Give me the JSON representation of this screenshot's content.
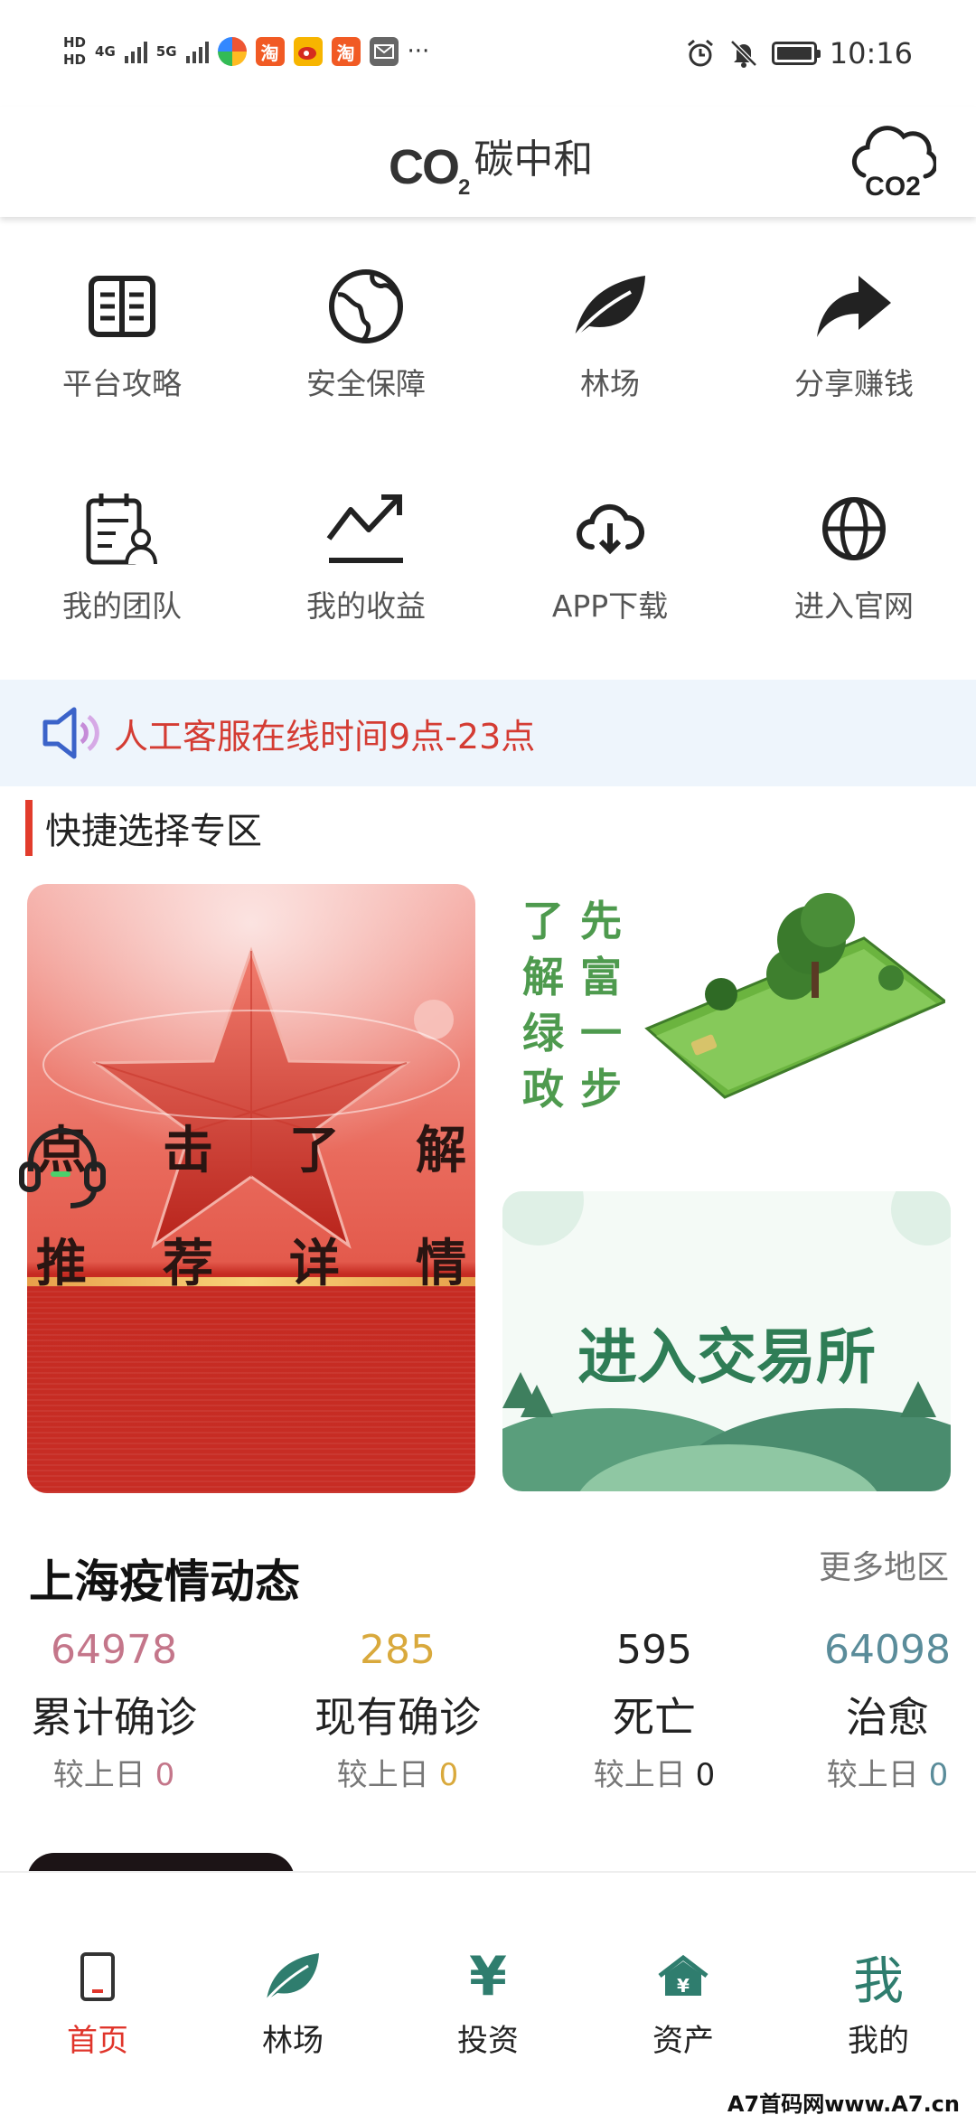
{
  "status_bar": {
    "hd1": "HD",
    "hd2": "HD",
    "net1": "4G",
    "net2": "5G",
    "app_taobao": "淘",
    "more": "···",
    "time": "10:16"
  },
  "header": {
    "co2_text": "CO",
    "co2_sub": "2",
    "title": "碳中和",
    "cloud_text": "CO2"
  },
  "menu": [
    {
      "label": "平台攻略",
      "icon": "book-icon"
    },
    {
      "label": "安全保障",
      "icon": "globe-map-icon"
    },
    {
      "label": "林场",
      "icon": "leaf-icon"
    },
    {
      "label": "分享赚钱",
      "icon": "share-arrow-icon"
    },
    {
      "label": "我的团队",
      "icon": "team-icon"
    },
    {
      "label": "我的收益",
      "icon": "trend-icon"
    },
    {
      "label": "APP下载",
      "icon": "cloud-download-icon"
    },
    {
      "label": "进入官网",
      "icon": "web-globe-icon"
    }
  ],
  "notice": {
    "text": "人工客服在线时间9点-23点"
  },
  "section": {
    "title": "快捷选择专区"
  },
  "banners": {
    "left": {
      "line1": [
        "点",
        "击",
        "了",
        "解"
      ],
      "line2": [
        "推",
        "荐",
        "详",
        "情"
      ]
    },
    "right_top": {
      "col1": "了解绿政",
      "col2": "先富一步"
    },
    "right_bottom": {
      "title": "进入交易所"
    }
  },
  "covid": {
    "title": "上海疫情动态",
    "more": "更多地区",
    "compare_label": "较上日",
    "stats": [
      {
        "value": "64978",
        "label": "累计确诊",
        "delta": "0",
        "color": "#c4768a"
      },
      {
        "value": "285",
        "label": "现有确诊",
        "delta": "0",
        "color": "#d9a93c"
      },
      {
        "value": "595",
        "label": "死亡",
        "delta": "0",
        "color": "#222222"
      },
      {
        "value": "64098",
        "label": "治愈",
        "delta": "0",
        "color": "#5a8c9a"
      }
    ]
  },
  "bottom_nav": [
    {
      "label": "首页",
      "icon": "phone-home-icon",
      "active": true
    },
    {
      "label": "林场",
      "icon": "leaf-nav-icon",
      "active": false
    },
    {
      "label": "投资",
      "icon": "yen-icon",
      "active": false
    },
    {
      "label": "资产",
      "icon": "house-yen-icon",
      "active": false
    },
    {
      "label": "我的",
      "icon": "me-icon",
      "active": false
    }
  ],
  "nav_glyphs": {
    "yen": "¥",
    "me": "我",
    "house_yen": "¥"
  },
  "watermark": "A7首码网www.A7.cn",
  "colors": {
    "accent_red": "#e0352b",
    "brand_green": "#2f7d6e",
    "notice_bg": "#eef5fc"
  }
}
